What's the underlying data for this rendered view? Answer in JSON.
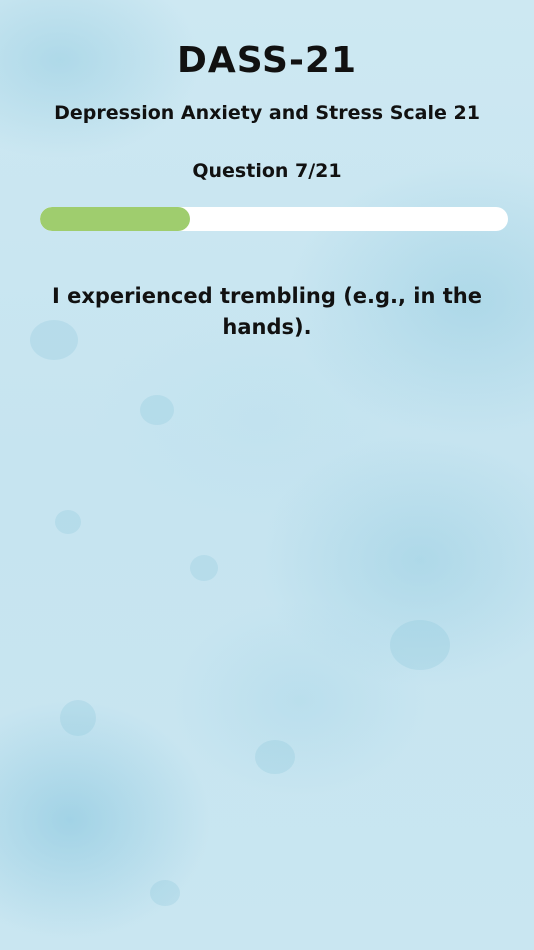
{
  "header": {
    "title": "DASS-21",
    "subtitle": "Depression Anxiety and Stress Scale 21"
  },
  "progress": {
    "label": "Question 7/21",
    "current": 7,
    "total": 21,
    "fraction": 0.32,
    "fill_color": "#9fcd6e",
    "track_color": "#ffffff"
  },
  "question": {
    "text": "I experienced trembling (e.g., in the hands)."
  },
  "theme": {
    "background_color": "#cde8f2"
  }
}
